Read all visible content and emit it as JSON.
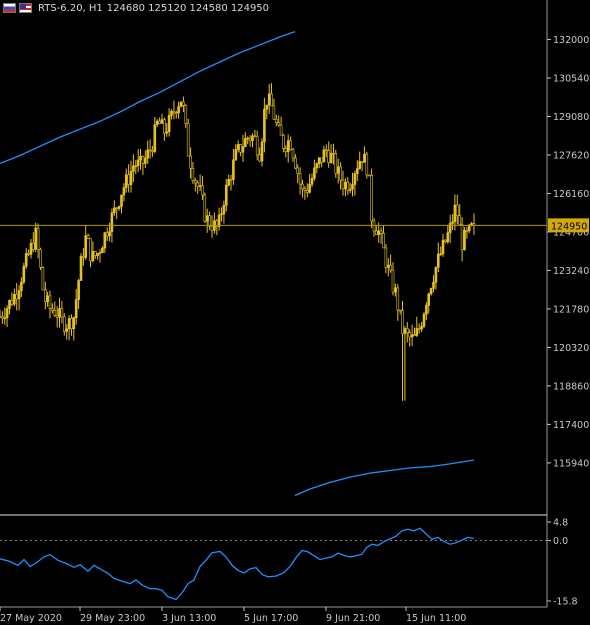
{
  "header": {
    "symbol": "RTS-6.20, H1",
    "ohlc": "124680 125120 124580 124950"
  },
  "price_axis": {
    "labels": [
      "132000",
      "130540",
      "129080",
      "127620",
      "126160",
      "124700",
      "123240",
      "121780",
      "120320",
      "118860",
      "117400",
      "115940"
    ],
    "current_price": "124950"
  },
  "indicator_axis": {
    "labels": [
      "4.8",
      "0.0",
      "-15.8"
    ]
  },
  "time_axis": {
    "labels": [
      "27 May 2020",
      "29 May 23:00",
      "3 Jun 13:00",
      "5 Jun 17:00",
      "9 Jun 21:00",
      "15 Jun 11:00"
    ]
  },
  "colors": {
    "background": "#000000",
    "candles": "#e6c21f",
    "current_price_line": "#b59a00",
    "price_label_bg": "#d4a90c",
    "envelope": "#1e90ff",
    "indicator": "#1e90ff",
    "axis_text": "#c8c8c8",
    "grid_separator": "#9a9a9a"
  },
  "chart_data": [
    {
      "type": "candlestick",
      "title": "RTS-6.20, H1",
      "ylim": [
        114000,
        133500
      ],
      "y_ticks": [
        132000,
        130540,
        129080,
        127620,
        126160,
        124700,
        123240,
        121780,
        120320,
        118860,
        117400,
        115940
      ],
      "current_price": 124950,
      "x_labels": [
        "27 May 2020",
        "29 May 23:00",
        "3 Jun 13:00",
        "5 Jun 17:00",
        "9 Jun 21:00",
        "15 Jun 11:00"
      ],
      "close_path": [
        [
          0,
          121500
        ],
        [
          8,
          121900
        ],
        [
          16,
          122400
        ],
        [
          24,
          123300
        ],
        [
          32,
          124200
        ],
        [
          36,
          124600
        ],
        [
          40,
          123400
        ],
        [
          44,
          122200
        ],
        [
          50,
          121800
        ],
        [
          56,
          121700
        ],
        [
          62,
          121300
        ],
        [
          68,
          121200
        ],
        [
          74,
          121500
        ],
        [
          80,
          123300
        ],
        [
          86,
          124500
        ],
        [
          92,
          123700
        ],
        [
          98,
          123900
        ],
        [
          104,
          124500
        ],
        [
          110,
          125100
        ],
        [
          116,
          125600
        ],
        [
          122,
          126300
        ],
        [
          128,
          126700
        ],
        [
          134,
          127300
        ],
        [
          140,
          127200
        ],
        [
          146,
          127500
        ],
        [
          152,
          128000
        ],
        [
          158,
          128900
        ],
        [
          164,
          128500
        ],
        [
          170,
          128900
        ],
        [
          176,
          129500
        ],
        [
          182,
          129800
        ],
        [
          188,
          127800
        ],
        [
          194,
          126800
        ],
        [
          200,
          126200
        ],
        [
          206,
          125200
        ],
        [
          212,
          125000
        ],
        [
          218,
          124800
        ],
        [
          224,
          126000
        ],
        [
          230,
          126800
        ],
        [
          236,
          127600
        ],
        [
          242,
          128000
        ],
        [
          248,
          128300
        ],
        [
          254,
          128300
        ],
        [
          260,
          127700
        ],
        [
          266,
          129800
        ],
        [
          272,
          129400
        ],
        [
          278,
          128500
        ],
        [
          284,
          128000
        ],
        [
          290,
          128200
        ],
        [
          296,
          127300
        ],
        [
          302,
          126200
        ],
        [
          308,
          126400
        ],
        [
          314,
          126900
        ],
        [
          320,
          127400
        ],
        [
          326,
          127800
        ],
        [
          332,
          127500
        ],
        [
          338,
          126900
        ],
        [
          344,
          126500
        ],
        [
          350,
          126600
        ],
        [
          356,
          127200
        ],
        [
          362,
          127600
        ],
        [
          368,
          127100
        ],
        [
          372,
          125100
        ],
        [
          378,
          124800
        ],
        [
          384,
          123900
        ],
        [
          390,
          123000
        ],
        [
          396,
          122300
        ],
        [
          402,
          121000
        ],
        [
          408,
          120700
        ],
        [
          414,
          120600
        ],
        [
          420,
          121100
        ],
        [
          426,
          122100
        ],
        [
          432,
          122900
        ],
        [
          438,
          123600
        ],
        [
          444,
          124200
        ],
        [
          450,
          124800
        ],
        [
          456,
          125700
        ],
        [
          462,
          124300
        ],
        [
          468,
          124600
        ],
        [
          474,
          124950
        ]
      ],
      "candle_count": 200,
      "spike_low": 118300
    },
    {
      "type": "line",
      "title": "",
      "ylim": [
        114000,
        133500
      ],
      "points_upper": [
        [
          0,
          127300
        ],
        [
          20,
          127600
        ],
        [
          40,
          127950
        ],
        [
          60,
          128300
        ],
        [
          80,
          128600
        ],
        [
          100,
          128900
        ],
        [
          120,
          129250
        ],
        [
          140,
          129650
        ],
        [
          160,
          130000
        ],
        [
          180,
          130400
        ],
        [
          200,
          130800
        ],
        [
          220,
          131150
        ],
        [
          240,
          131500
        ],
        [
          260,
          131800
        ],
        [
          280,
          132100
        ],
        [
          295,
          132300
        ]
      ],
      "points_lower": [
        [
          295,
          114700
        ],
        [
          310,
          114950
        ],
        [
          330,
          115200
        ],
        [
          350,
          115400
        ],
        [
          370,
          115550
        ],
        [
          390,
          115650
        ],
        [
          410,
          115750
        ],
        [
          430,
          115800
        ],
        [
          450,
          115900
        ],
        [
          474,
          116050
        ]
      ]
    },
    {
      "type": "line",
      "title": "",
      "ylim": [
        -15.8,
        4.8
      ],
      "y_ticks": [
        4.8,
        0.0,
        -15.8
      ],
      "reference_level": 0.0,
      "points": [
        [
          0,
          -4.8
        ],
        [
          10,
          -5.5
        ],
        [
          18,
          -6.5
        ],
        [
          24,
          -5.0
        ],
        [
          30,
          -6.8
        ],
        [
          36,
          -5.9
        ],
        [
          44,
          -4.3
        ],
        [
          50,
          -3.7
        ],
        [
          58,
          -5.2
        ],
        [
          66,
          -6.0
        ],
        [
          74,
          -7.0
        ],
        [
          80,
          -6.3
        ],
        [
          88,
          -8.0
        ],
        [
          94,
          -6.5
        ],
        [
          100,
          -7.4
        ],
        [
          108,
          -8.6
        ],
        [
          114,
          -9.9
        ],
        [
          122,
          -10.6
        ],
        [
          130,
          -11.3
        ],
        [
          136,
          -10.3
        ],
        [
          142,
          -11.6
        ],
        [
          150,
          -12.6
        ],
        [
          156,
          -12.6
        ],
        [
          162,
          -13.0
        ],
        [
          168,
          -14.7
        ],
        [
          176,
          -15.4
        ],
        [
          182,
          -13.7
        ],
        [
          188,
          -11.3
        ],
        [
          194,
          -10.3
        ],
        [
          200,
          -6.8
        ],
        [
          206,
          -5.2
        ],
        [
          212,
          -3.2
        ],
        [
          220,
          -2.9
        ],
        [
          226,
          -4.3
        ],
        [
          232,
          -6.5
        ],
        [
          238,
          -7.8
        ],
        [
          244,
          -8.5
        ],
        [
          250,
          -7.4
        ],
        [
          256,
          -7.1
        ],
        [
          262,
          -8.9
        ],
        [
          268,
          -9.5
        ],
        [
          276,
          -9.3
        ],
        [
          284,
          -8.4
        ],
        [
          290,
          -6.8
        ],
        [
          296,
          -4.5
        ],
        [
          302,
          -2.6
        ],
        [
          308,
          -3.0
        ],
        [
          314,
          -4.0
        ],
        [
          320,
          -5.0
        ],
        [
          326,
          -4.6
        ],
        [
          332,
          -4.3
        ],
        [
          338,
          -3.3
        ],
        [
          344,
          -3.9
        ],
        [
          350,
          -4.3
        ],
        [
          356,
          -4.0
        ],
        [
          362,
          -3.6
        ],
        [
          366,
          -2.0
        ],
        [
          372,
          -1.0
        ],
        [
          378,
          -1.3
        ],
        [
          384,
          -0.3
        ],
        [
          390,
          0.4
        ],
        [
          396,
          1.1
        ],
        [
          402,
          2.5
        ],
        [
          408,
          2.9
        ],
        [
          414,
          2.5
        ],
        [
          420,
          3.2
        ],
        [
          426,
          1.7
        ],
        [
          432,
          0.3
        ],
        [
          438,
          0.8
        ],
        [
          444,
          -0.3
        ],
        [
          450,
          -1.0
        ],
        [
          456,
          -0.6
        ],
        [
          462,
          0.1
        ],
        [
          468,
          0.8
        ],
        [
          474,
          0.5
        ]
      ]
    }
  ]
}
